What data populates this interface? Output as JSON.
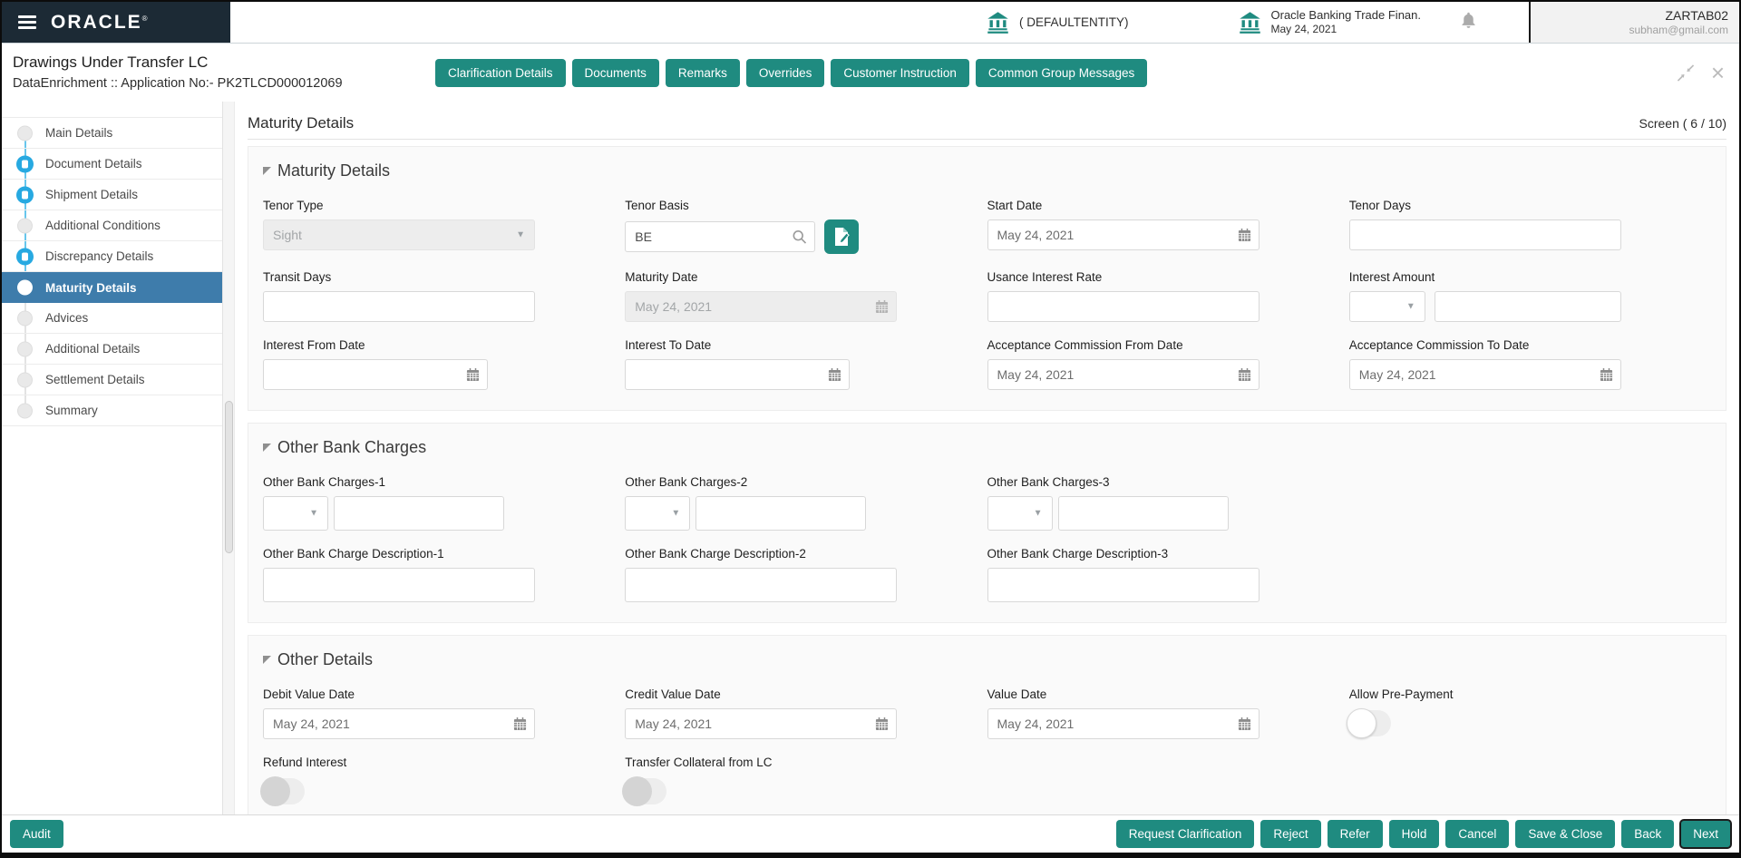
{
  "colors": {
    "accent_teal": "#1f8b80",
    "selected_blue": "#3e7cab",
    "progress_blue": "#27a9e1",
    "brand_dark": "#1c2a35"
  },
  "topbar": {
    "brand": "ORACLE",
    "entity": "( DEFAULTENTITY)",
    "app_name": "Oracle Banking Trade Finan.",
    "app_date": "May 24, 2021",
    "user_id": "ZARTAB02",
    "user_email": "subham@gmail.com"
  },
  "task_header": {
    "title": "Drawings Under Transfer LC",
    "subtitle": "DataEnrichment ::  Application No:- PK2TLCD000012069",
    "actions": [
      "Clarification Details",
      "Documents",
      "Remarks",
      "Overrides",
      "Customer Instruction",
      "Common Group Messages"
    ]
  },
  "sidebar": {
    "items": [
      {
        "label": "Main Details",
        "state": "pending"
      },
      {
        "label": "Document Details",
        "state": "progress"
      },
      {
        "label": "Shipment Details",
        "state": "progress"
      },
      {
        "label": "Additional Conditions",
        "state": "pending"
      },
      {
        "label": "Discrepancy Details",
        "state": "progress"
      },
      {
        "label": "Maturity Details",
        "state": "active"
      },
      {
        "label": "Advices",
        "state": "pending"
      },
      {
        "label": "Additional Details",
        "state": "pending"
      },
      {
        "label": "Settlement Details",
        "state": "pending"
      },
      {
        "label": "Summary",
        "state": "pending"
      }
    ]
  },
  "content": {
    "page_title": "Maturity Details",
    "screen_indicator": "Screen ( 6 / 10)",
    "maturity": {
      "section_title": "Maturity Details",
      "tenor_type": {
        "label": "Tenor Type",
        "value": "Sight"
      },
      "tenor_basis": {
        "label": "Tenor Basis",
        "value": "BE"
      },
      "start_date": {
        "label": "Start Date",
        "value": "May 24, 2021"
      },
      "tenor_days": {
        "label": "Tenor Days",
        "value": ""
      },
      "transit_days": {
        "label": "Transit Days",
        "value": ""
      },
      "maturity_date": {
        "label": "Maturity Date",
        "value": "May 24, 2021"
      },
      "usance_interest_rate": {
        "label": "Usance Interest Rate",
        "value": ""
      },
      "interest_amount": {
        "label": "Interest Amount",
        "currency": "",
        "value": ""
      },
      "interest_from_date": {
        "label": "Interest From Date",
        "value": ""
      },
      "interest_to_date": {
        "label": "Interest To Date",
        "value": ""
      },
      "acceptance_commission_from_date": {
        "label": "Acceptance Commission From Date",
        "value": "May 24, 2021"
      },
      "acceptance_commission_to_date": {
        "label": "Acceptance Commission To Date",
        "value": "May 24, 2021"
      }
    },
    "other_bank_charges": {
      "section_title": "Other Bank Charges",
      "charges": [
        {
          "label": "Other Bank Charges-1",
          "currency": "",
          "value": ""
        },
        {
          "label": "Other Bank Charges-2",
          "currency": "",
          "value": ""
        },
        {
          "label": "Other Bank Charges-3",
          "currency": "",
          "value": ""
        }
      ],
      "descriptions": [
        {
          "label": "Other Bank Charge Description-1",
          "value": ""
        },
        {
          "label": "Other Bank Charge Description-2",
          "value": ""
        },
        {
          "label": "Other Bank Charge Description-3",
          "value": ""
        }
      ]
    },
    "other_details": {
      "section_title": "Other Details",
      "debit_value_date": {
        "label": "Debit Value Date",
        "value": "May 24, 2021"
      },
      "credit_value_date": {
        "label": "Credit Value Date",
        "value": "May 24, 2021"
      },
      "value_date": {
        "label": "Value Date",
        "value": "May 24, 2021"
      },
      "allow_pre_payment": {
        "label": "Allow Pre-Payment",
        "value": "off"
      },
      "refund_interest": {
        "label": "Refund Interest",
        "value": "off"
      },
      "transfer_collateral_from_lc": {
        "label": "Transfer Collateral from LC",
        "value": "off"
      }
    }
  },
  "footer": {
    "audit": "Audit",
    "actions": [
      "Request Clarification",
      "Reject",
      "Refer",
      "Hold",
      "Cancel",
      "Save & Close",
      "Back",
      "Next"
    ]
  }
}
